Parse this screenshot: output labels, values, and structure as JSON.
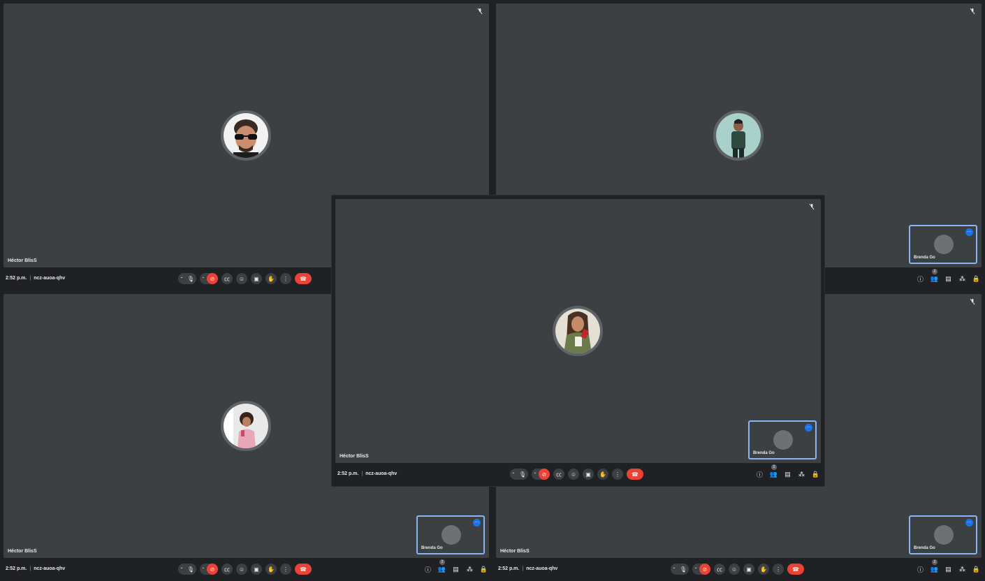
{
  "meeting": {
    "time": "2:52 p.m.",
    "code": "ncz-auoa-qhv"
  },
  "participants": {
    "self": "Héctor BlisS",
    "pip_name": "Brenda Go",
    "participant_count": "2"
  },
  "icons": {
    "mic": "microphone-icon",
    "cam_off": "camera-off-icon",
    "captions": "captions-icon",
    "emoji": "emoji-icon",
    "present": "present-screen-icon",
    "hand": "raise-hand-icon",
    "more": "more-options-icon",
    "end": "end-call-icon",
    "info": "info-icon",
    "people": "people-icon",
    "chat": "chat-icon",
    "activities": "activities-icon",
    "lock": "host-controls-icon",
    "muted": "muted-mic-icon"
  },
  "colors": {
    "tile_bg": "#3c4043",
    "bar_bg": "#202124",
    "end_call": "#ea4335",
    "pip_border": "#8ab4f8",
    "pip_menu": "#1a73e8"
  }
}
